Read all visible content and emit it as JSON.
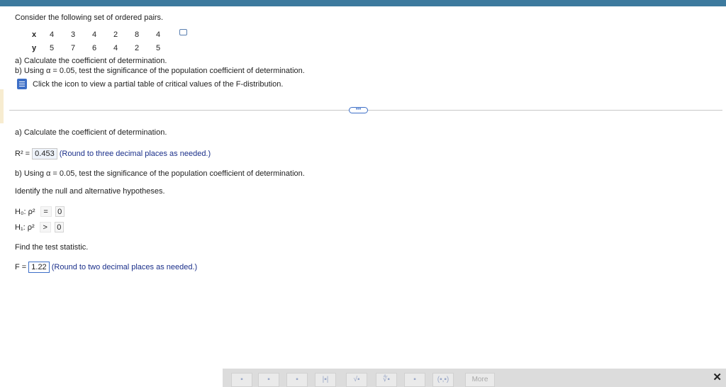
{
  "question": {
    "intro": "Consider the following set of ordered pairs.",
    "pairs": {
      "x_label": "x",
      "y_label": "y",
      "x": [
        "4",
        "3",
        "4",
        "2",
        "8",
        "4"
      ],
      "y": [
        "5",
        "7",
        "6",
        "4",
        "2",
        "5"
      ]
    },
    "part_a": "a) Calculate the coefficient of determination.",
    "part_b": "b) Using α = 0.05, test the significance of the population coefficient of determination.",
    "table_link": "Click the icon to view a partial table of critical values of the F-distribution."
  },
  "work": {
    "part_a_heading": "a) Calculate the coefficient of determination.",
    "r2_label": "R² =",
    "r2_value": "0.453",
    "r2_hint": "(Round to three decimal places as needed.)",
    "part_b_heading": "b) Using α = 0.05, test the significance of the population coefficient of determination.",
    "hypotheses_prompt": "Identify the null and alternative hypotheses.",
    "h0_label": "H₀: ρ²",
    "h0_op": "=",
    "h0_value": "0",
    "h1_label": "H₁: ρ²",
    "h1_op": ">",
    "h1_value": "0",
    "test_stat_prompt": "Find the test statistic.",
    "f_label": "F =",
    "f_value": "1.22",
    "f_hint": "(Round to two decimal places as needed.)"
  },
  "divider_pill": "•••",
  "toolbar": {
    "more_label": "More",
    "close_glyph": "✕",
    "tools": [
      "fraction",
      "mixed-number",
      "exponent",
      "absolute-value",
      "square-root",
      "nth-root",
      "subscript",
      "interval"
    ]
  },
  "colors": {
    "top_bar": "#3d7a9e",
    "hint_text": "#1a2f8a",
    "accent": "#3d6fc7"
  }
}
